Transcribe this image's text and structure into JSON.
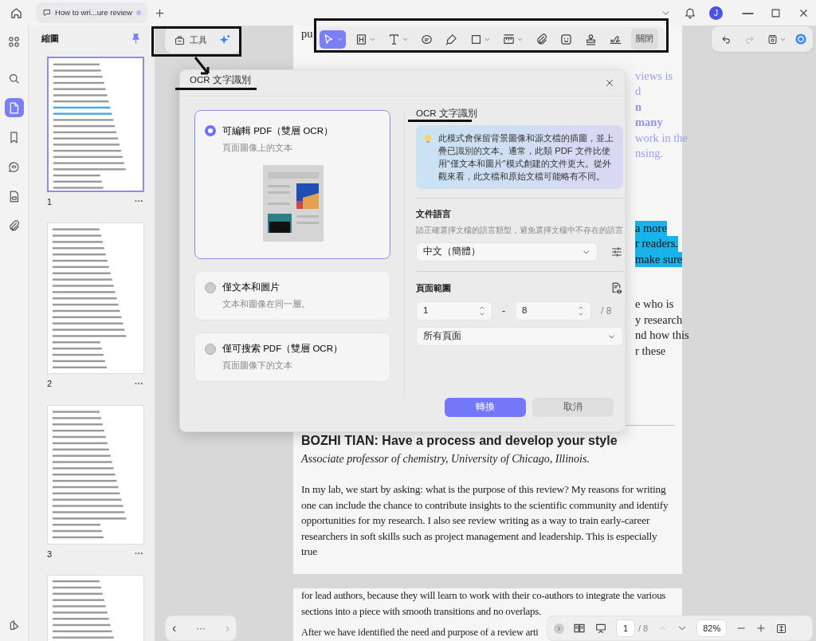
{
  "titlebar": {
    "tab": {
      "title": "How to wri...ure review",
      "unsaved": true
    },
    "avatar": "J"
  },
  "rail": [
    {
      "selected": false
    },
    {
      "selected": false
    },
    {
      "selected": true
    },
    {
      "selected": false
    },
    {
      "selected": false
    },
    {
      "selected": false
    },
    {
      "selected": false
    }
  ],
  "thumbnails": {
    "title": "縮圖",
    "pages": [
      {
        "number": "1",
        "selected": true
      },
      {
        "number": "2",
        "selected": false
      },
      {
        "number": "3",
        "selected": false
      },
      {
        "selected": false
      }
    ]
  },
  "tools_panel": {
    "label": "工具"
  },
  "toolbar": {
    "tools": [
      {
        "selected": true,
        "menu": true
      },
      {
        "selected": false,
        "menu": true
      },
      {
        "selected": false,
        "menu": true
      },
      {
        "selected": false,
        "menu": false
      },
      {
        "selected": false,
        "menu": false
      },
      {
        "selected": false,
        "menu": true
      },
      {
        "selected": false,
        "menu": true
      },
      {
        "selected": false,
        "menu": false
      },
      {
        "selected": false,
        "menu": false
      },
      {
        "selected": false,
        "menu": false
      },
      {
        "selected": false,
        "menu": false
      }
    ],
    "close": "關閉"
  },
  "quick_actions": [
    {
      "disabled": false
    },
    {
      "disabled": true
    },
    {
      "disabled": false
    }
  ],
  "document": {
    "top_line": "pu",
    "fragment_groups": [
      [
        {
          "text": "views is",
          "kind": "link"
        },
        {
          "text": "d",
          "kind": "link"
        },
        {
          "text": "n",
          "kind": "link_bold"
        },
        {
          "text": "many",
          "kind": "link_bold"
        },
        {
          "text": "work in the",
          "kind": "link"
        },
        {
          "text": "nsing.",
          "kind": "link"
        }
      ],
      [
        {
          "text": "a more",
          "kind": "highlight"
        },
        {
          "text": "r readers.",
          "kind": "highlight"
        },
        {
          "text": "make sure",
          "kind": "highlight"
        }
      ],
      [
        {
          "text": "e who is",
          "kind": "plain"
        },
        {
          "text": "y research",
          "kind": "plain"
        },
        {
          "text": "nd how this",
          "kind": "plain"
        },
        {
          "text": "r these",
          "kind": "plain"
        }
      ]
    ],
    "heading": "BOZHI TIAN: Have a process and develop your style",
    "affiliation": "Associate professor of chemistry, University of Chicago, Illinois.",
    "paragraph": "In my lab, we start by asking: what is the purpose of this review? My reasons for writing one can include the chance to contribute insights to the scientific community and identify opportunities for my research. I also see review writing as a way to train early-career researchers in soft skills such as project management and leadership. This is especially true",
    "next_page_paragraph": "for lead authors, because they will learn to work with their co-authors to integrate the various sections into a piece with smooth transitions and no overlaps.",
    "next_page_last_line": "After we have identified the need and purpose of a review arti"
  },
  "dialog": {
    "title": "OCR 文字識別",
    "options": [
      {
        "title": "可編輯 PDF（雙層 OCR）",
        "subtitle": "頁面圖像上的文本",
        "selected": true
      },
      {
        "title": "僅文本和圖片",
        "subtitle": "文本和圖像在同一層。",
        "selected": false
      },
      {
        "title": "僅可搜索 PDF（雙層 OCR）",
        "subtitle": "頁面圖像下的文本",
        "selected": false
      }
    ],
    "section_title": "OCR 文字識別",
    "info": "此模式會保留背景圖像和源文檔的插圖，並上疊已識別的文本。通常，此類 PDF 文件比使用“僅文本和圖片”模式創建的文件更大。從外觀來看，此文檔和原始文檔可能略有不同。",
    "language_label": "文件語言",
    "language_hint": "請正確選擇文檔的語言類型，避免選擇文檔中不存在的語言",
    "language": "中文（簡體）",
    "range_label": "頁面範圍",
    "range_from": "1",
    "range_dash": "-",
    "range_to": "8",
    "range_total": "/ 8",
    "range_mode": "所有頁面",
    "convert": "轉換",
    "cancel": "取消"
  },
  "nav": {
    "prev": "‹",
    "more": "···",
    "next": "›"
  },
  "statusbar": {
    "page": "1",
    "total": "/ 8",
    "prev_disabled": true,
    "zoom": "82%"
  }
}
